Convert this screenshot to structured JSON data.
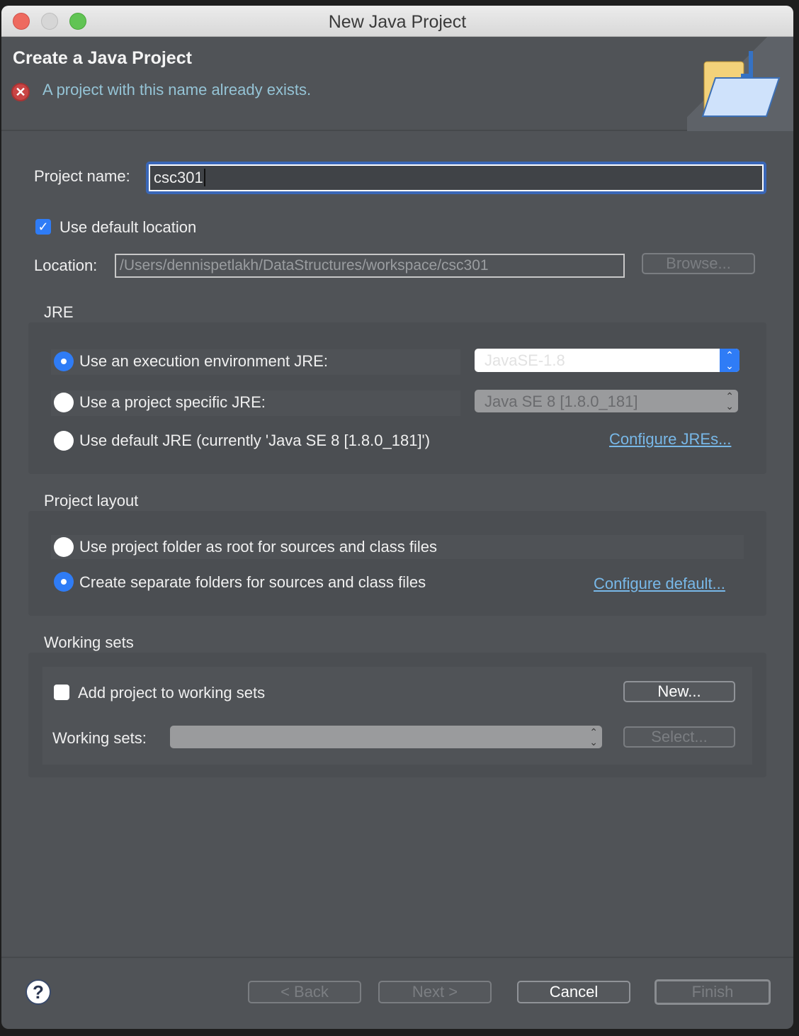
{
  "window": {
    "title": "New Java Project"
  },
  "header": {
    "title": "Create a Java Project",
    "error_message": "A project with this name already exists."
  },
  "project_name": {
    "label": "Project name:",
    "value": "csc301"
  },
  "use_default_location": {
    "label": "Use default location",
    "checked": true
  },
  "location": {
    "label": "Location:",
    "value": "/Users/dennispetlakh/DataStructures/workspace/csc301",
    "browse_label": "Browse..."
  },
  "jre": {
    "heading": "JRE",
    "option_env": "Use an execution environment JRE:",
    "env_value": "JavaSE-1.8",
    "option_specific": "Use a project specific JRE:",
    "specific_value": "Java SE 8 [1.8.0_181]",
    "option_default": "Use default JRE (currently 'Java SE 8 [1.8.0_181]')",
    "configure_link": "Configure JREs...",
    "selected": "option_env"
  },
  "layout": {
    "heading": "Project layout",
    "option_root": "Use project folder as root for sources and class files",
    "option_separate": "Create separate folders for sources and class files",
    "configure_link": "Configure default...",
    "selected": "option_separate"
  },
  "working_sets": {
    "heading": "Working sets",
    "add_label": "Add project to working sets",
    "add_checked": false,
    "new_label": "New...",
    "sets_label": "Working sets:",
    "select_label": "Select..."
  },
  "footer": {
    "back": "< Back",
    "next": "Next >",
    "cancel": "Cancel",
    "finish": "Finish"
  },
  "colors": {
    "accent": "#2f7cf6",
    "error_text": "#95c4d6",
    "link": "#78b8e8"
  }
}
